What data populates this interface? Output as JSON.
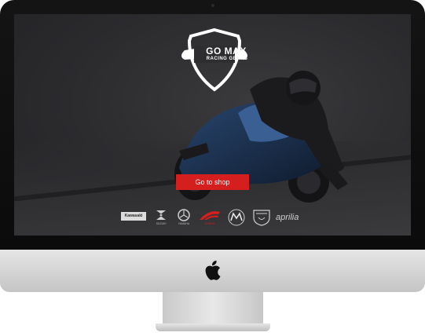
{
  "site": {
    "logo": {
      "title": "GO MAX",
      "subtitle": "RACING GEARS",
      "icon": "shield-helmet-logo"
    },
    "cta": {
      "label": "Go to shop"
    },
    "brands": [
      {
        "name": "Kawasaki",
        "icon": "kawasaki-logo"
      },
      {
        "name": "SUZUKI",
        "icon": "suzuki-logo"
      },
      {
        "name": "YAMAHA",
        "icon": "yamaha-logo"
      },
      {
        "name": "HONDA",
        "icon": "honda-logo"
      },
      {
        "name": "",
        "icon": "mv-agusta-logo"
      },
      {
        "name": "",
        "icon": "ducati-logo"
      },
      {
        "name": "aprilia",
        "icon": "aprilia-logo"
      }
    ]
  },
  "colors": {
    "accent": "#d51f1f",
    "screen_bg": "#2b2b2e",
    "bezel": "#111111",
    "chin": "#d2d2d2"
  },
  "device": {
    "type": "desktop monitor",
    "icon": "apple-logo"
  }
}
